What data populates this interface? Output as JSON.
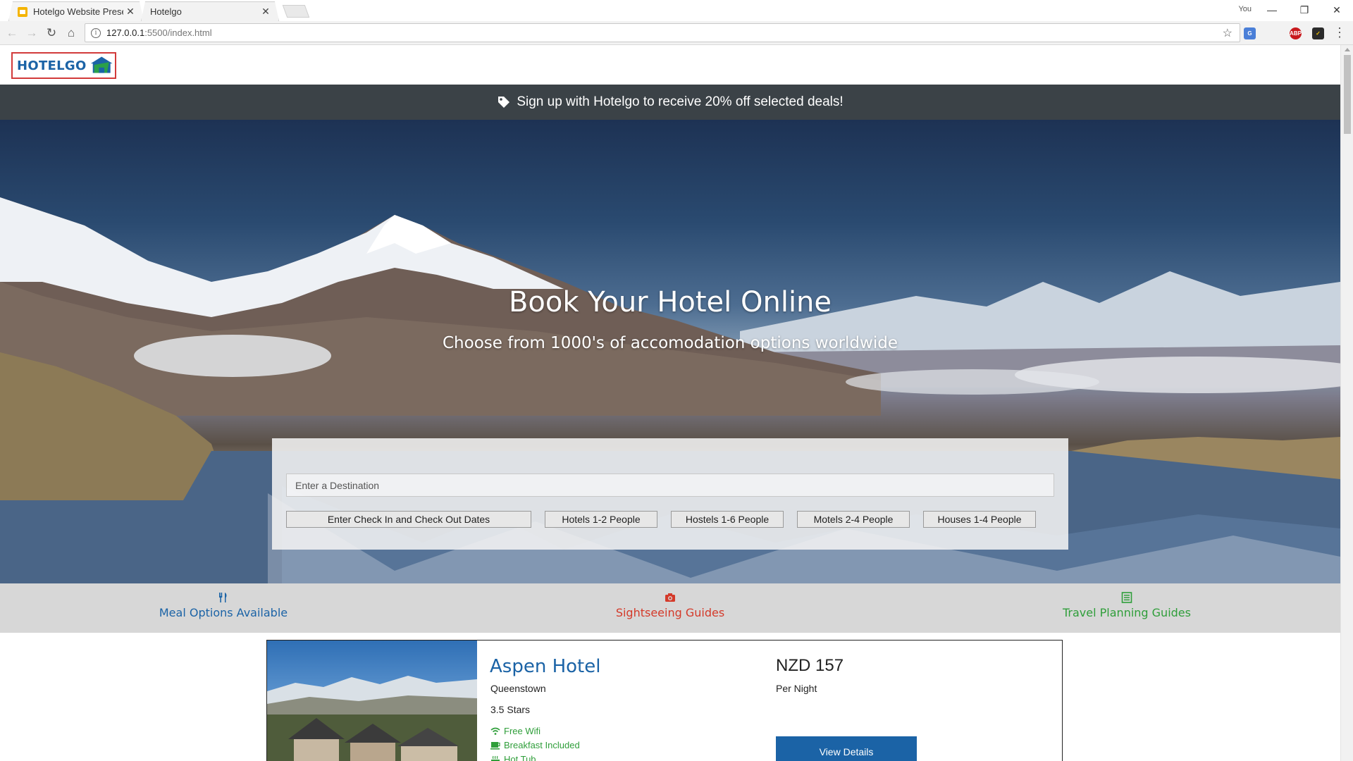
{
  "browser": {
    "tabs": [
      {
        "title": "Hotelgo Website Present"
      },
      {
        "title": "Hotelgo"
      }
    ],
    "user_label": "You",
    "url_host": "127.0.0.1",
    "url_path": ":5500/index.html"
  },
  "site": {
    "logo_text": "HOTELGO",
    "promo": "Sign up with Hotelgo to receive 20% off selected deals!",
    "hero": {
      "title": "Book Your Hotel Online",
      "subtitle": "Choose from 1000's of accomodation options worldwide"
    },
    "search": {
      "destination_placeholder": "Enter a Destination",
      "dates_button": "Enter Check In and Check Out Dates",
      "filters": [
        "Hotels 1-2 People",
        "Hostels 1-6 People",
        "Motels 2-4 People",
        "Houses 1-4 People"
      ]
    },
    "features": [
      {
        "label": "Meal Options Available",
        "icon": "utensils-icon",
        "color": "#1b63a6"
      },
      {
        "label": "Sightseeing Guides",
        "icon": "camera-icon",
        "color": "#d43a2a"
      },
      {
        "label": "Travel Planning Guides",
        "icon": "list-icon",
        "color": "#2f9e3a"
      }
    ],
    "hotel": {
      "name": "Aspen Hotel",
      "city": "Queenstown",
      "stars": "3.5 Stars",
      "amenities": [
        "Free Wifi",
        "Breakfast Included",
        "Hot Tub"
      ],
      "price": "NZD 157",
      "per_night": "Per Night",
      "view_button": "View Details"
    }
  },
  "colors": {
    "brand_blue": "#1b63a6",
    "logo_border": "#d23a3a",
    "promo_bg": "#3b4247",
    "features_bg": "#d7d7d7",
    "amenity_green": "#2f9e3a"
  }
}
